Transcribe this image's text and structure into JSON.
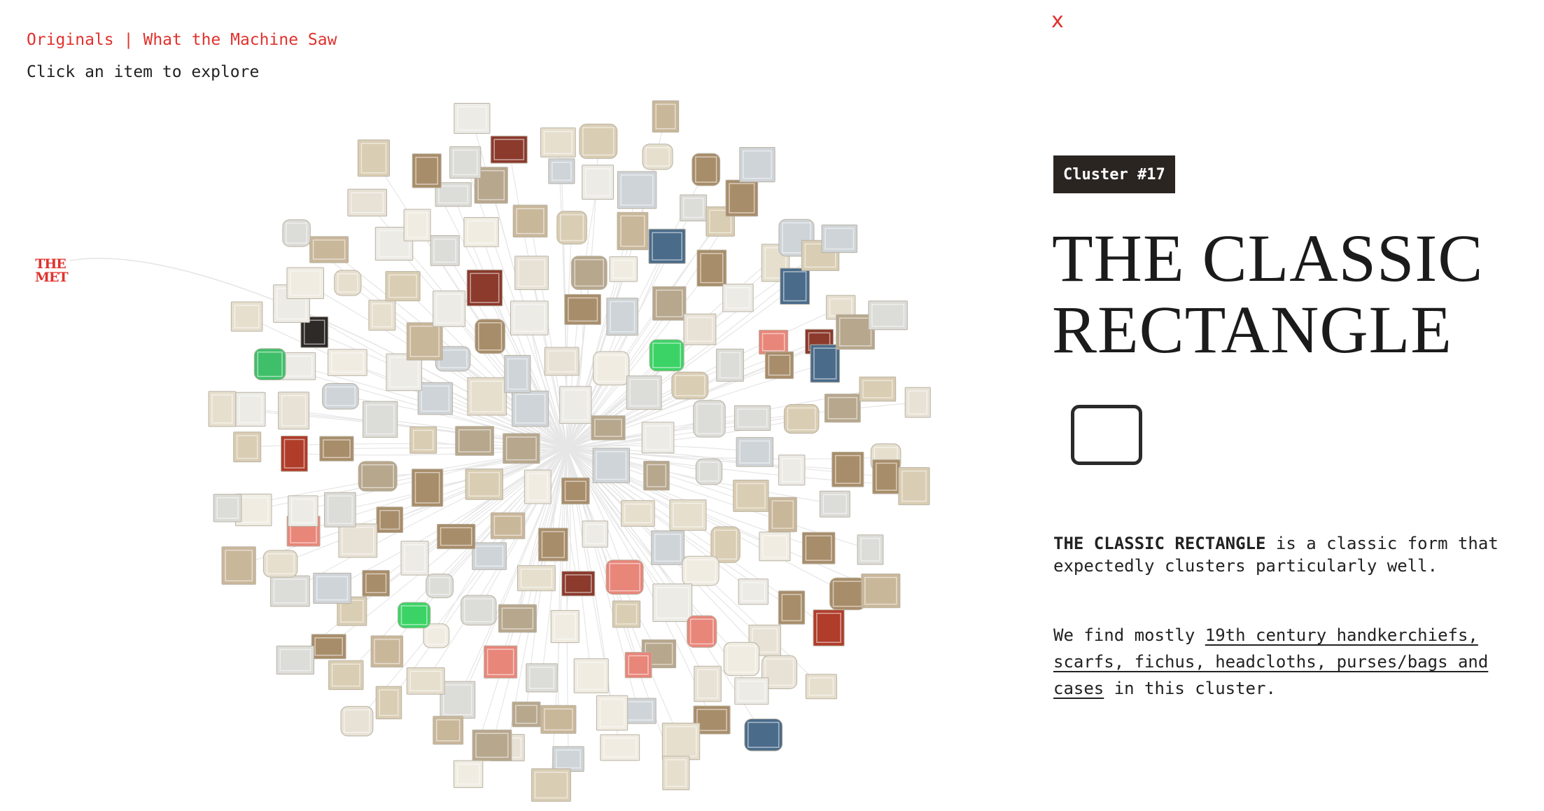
{
  "nav": {
    "originals": "Originals",
    "separator": "|",
    "machine": "What the Machine Saw"
  },
  "hint": "Click an item to explore",
  "logo": {
    "line1": "THE",
    "line2": "MET"
  },
  "close_label": "x",
  "cluster": {
    "badge": "Cluster #17",
    "title": "THE CLASSIC RECTANGLE",
    "shape_icon": "rounded-rectangle-icon",
    "description_bold": "THE CLASSIC RECTANGLE",
    "description_rest": " is a classic form that expectedly clusters particularly well.",
    "find_prefix": "We find mostly ",
    "find_link": "19th century handkerchiefs, scarfs, fichus, headcloths, purses/bags and cases",
    "find_suffix": " in this cluster."
  },
  "colors": {
    "accent": "#e0322e",
    "badge_bg": "#2b2522",
    "item_palette": [
      "#dcdcd8",
      "#e6dfce",
      "#d9cdb3",
      "#c9b79a",
      "#ecebe6",
      "#b7a78d",
      "#e8e2d6",
      "#cfd4d8",
      "#a88d6a",
      "#f0ece2"
    ],
    "highlight_items": [
      "#3fbf6a",
      "#3cd366",
      "#e8867a",
      "#b03c2a",
      "#2d2a28",
      "#8b3a2c",
      "#4a6b8a"
    ]
  }
}
